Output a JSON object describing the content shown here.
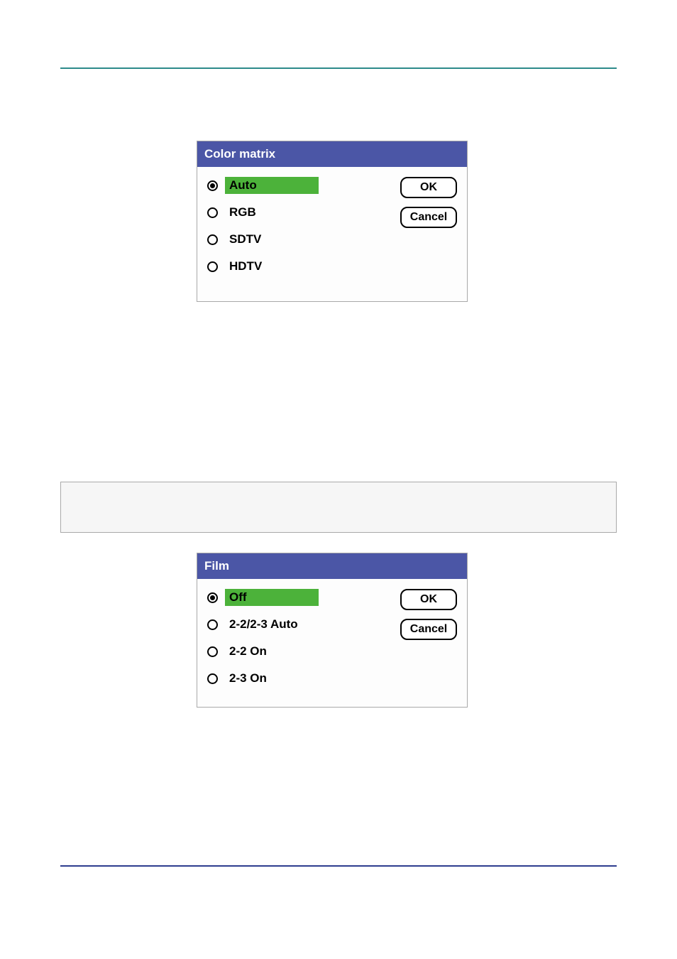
{
  "color_matrix": {
    "title": "Color matrix",
    "options": [
      "Auto",
      "RGB",
      "SDTV",
      "HDTV"
    ],
    "selected_index": 0,
    "buttons": {
      "ok": "OK",
      "cancel": "Cancel"
    }
  },
  "film": {
    "title": "Film",
    "options": [
      "Off",
      "2-2/2-3 Auto",
      "2-2 On",
      "2-3 On"
    ],
    "selected_index": 0,
    "buttons": {
      "ok": "OK",
      "cancel": "Cancel"
    }
  }
}
